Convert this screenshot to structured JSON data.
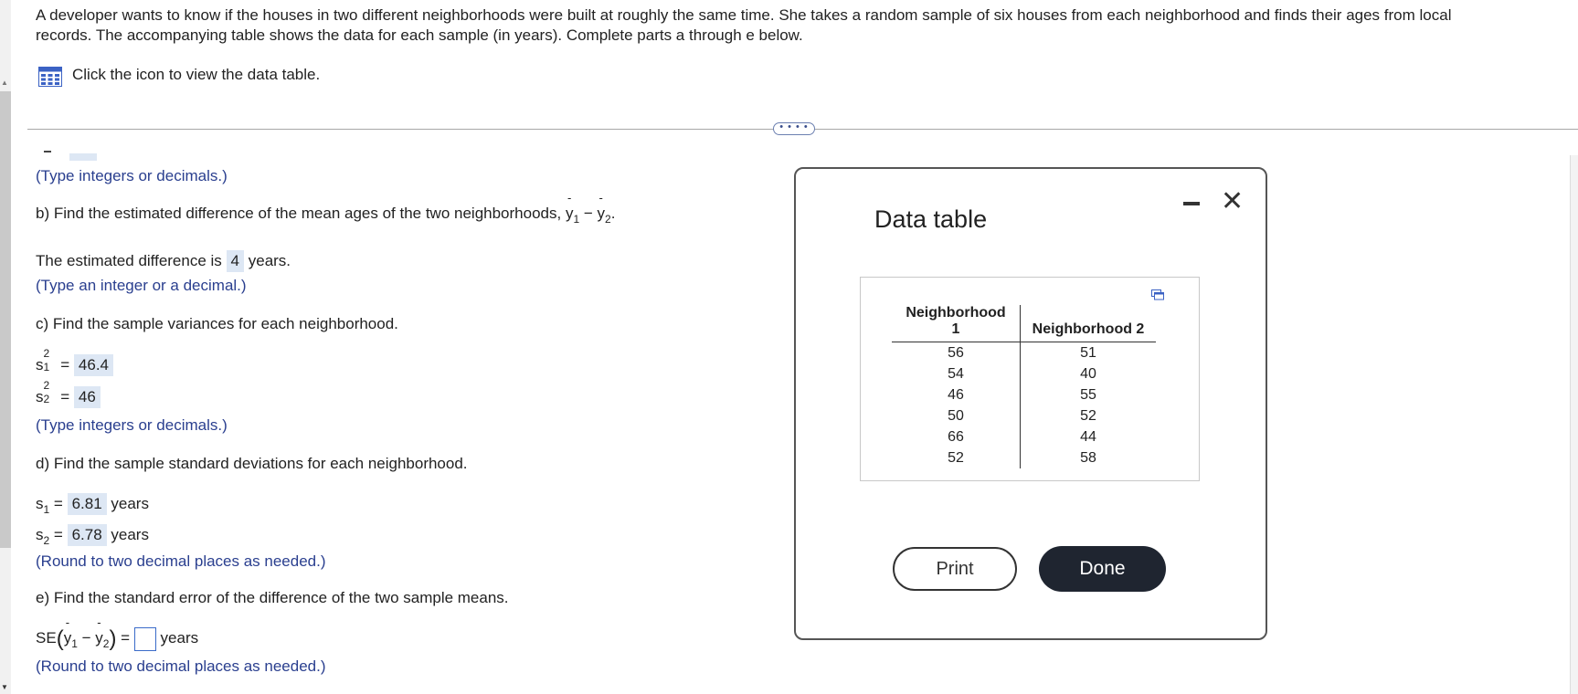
{
  "problem": {
    "intro_line1": "A developer wants to know if the houses in two different neighborhoods were built at roughly the same time. She takes a random sample of six houses from each neighborhood and finds their ages from local",
    "intro_line2": "records. The accompanying table shows the data for each sample (in years). Complete parts a through e below.",
    "table_link": "Click the icon to view the data table.",
    "divider_dots": "• • • •"
  },
  "parts": {
    "a_hint": "(Type integers or decimals.)",
    "b_question": "b) Find the estimated difference of the mean ages of the two neighborhoods,",
    "b_answer_prefix": "The estimated difference is",
    "b_answer_value": "4",
    "b_answer_suffix": "years.",
    "b_hint": "(Type an integer or a decimal.)",
    "c_question": "c) Find the sample variances for each neighborhood.",
    "c_s1_value": "46.4",
    "c_s2_value": "46",
    "c_hint": "(Type integers or decimals.)",
    "d_question": "d) Find the sample standard deviations for each neighborhood.",
    "d_s1_value": "6.81",
    "d_s2_value": "6.78",
    "d_unit": "years",
    "d_hint": "(Round to two decimal places as needed.)",
    "e_question": "e) Find the standard error of the difference of the two sample means.",
    "e_label": "SE",
    "e_unit": "years",
    "e_hint": "(Round to two decimal places as needed.)"
  },
  "modal": {
    "title": "Data table",
    "columns": [
      "Neighborhood 1",
      "Neighborhood 2"
    ],
    "col1_line1": "Neighborhood",
    "col1_line2": "1",
    "col2": "Neighborhood 2",
    "rows": [
      [
        "56",
        "51"
      ],
      [
        "54",
        "40"
      ],
      [
        "46",
        "55"
      ],
      [
        "50",
        "52"
      ],
      [
        "66",
        "44"
      ],
      [
        "52",
        "58"
      ]
    ],
    "print_label": "Print",
    "done_label": "Done",
    "close_glyph": "✕"
  },
  "icons": {
    "table_icon": "grid-table-icon",
    "expand_icon": "popout-icon",
    "minimize_icon": "minimize-icon",
    "close_icon": "close-icon"
  },
  "colors": {
    "hint_text": "#2a3f8f",
    "answer_bg": "#dde7f4",
    "done_button": "#1f2530",
    "table_icon": "#3b62c4"
  }
}
